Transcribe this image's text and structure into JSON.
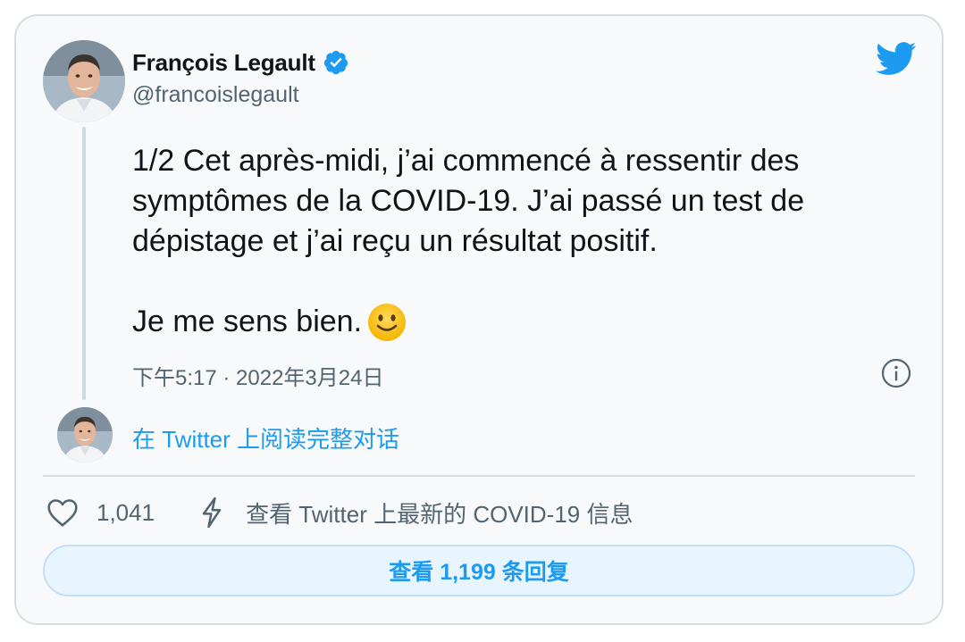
{
  "author": {
    "name": "François Legault",
    "handle": "@francoislegault",
    "verified": true,
    "avatar_icon": "avatar-photo"
  },
  "tweet": {
    "text_para1": "1/2 Cet après-midi, j’ai commencé à ressentir des symptômes de la COVID-19. J’ai passé un test de dépistage et j’ai reçu un résultat positif.",
    "text_para2": "Je me sens bien.",
    "emoji": "slightly-smiling-face",
    "timestamp": "下午5:17 · 2022年3月24日"
  },
  "thread": {
    "read_full_label": "在 Twitter 上阅读完整对话"
  },
  "actions": {
    "like_count": "1,041",
    "covid_info_label": "查看 Twitter 上最新的 COVID-19 信息",
    "replies_label": "查看 1,199 条回复"
  },
  "colors": {
    "accent": "#1d9bf0",
    "text": "#0f1419",
    "secondary_text": "#536471",
    "card_bg": "#f7f9fa",
    "border": "#d6dde3"
  },
  "icons": [
    "verified-badge-icon",
    "twitter-bird-icon",
    "info-icon",
    "heart-icon",
    "bolt-icon",
    "smile-emoji-icon"
  ]
}
